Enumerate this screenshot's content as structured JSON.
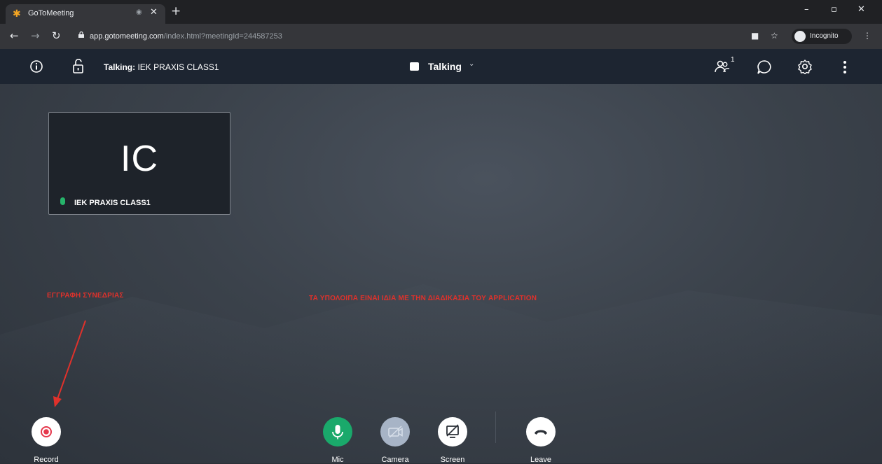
{
  "browser": {
    "tab_title": "GoToMeeting",
    "new_tab": "+",
    "url_host": "app.gotomeeting.com",
    "url_path": "/index.html?meetingId=244587253",
    "incognito_label": "Incognito"
  },
  "header": {
    "talking_prefix": "Talking:",
    "talking_name": "IEK PRAXIS CLASS1",
    "mode_label": "Talking",
    "attendee_count": "1"
  },
  "participant": {
    "initials": "IC",
    "name": "IEK PRAXIS CLASS1"
  },
  "annotations": {
    "record_note": "ΕΓΓΡΑΦΗ ΣΥΝΕΔΡΙΑΣ",
    "main_note": "ΤΑ ΥΠΟΛΟΙΠΑ ΕΙΝΑΙ ΙΔΙΑ ΜΕ ΤΗΝ ΔΙΑΔΙΚΑΣΙΑ ΤΟΥ APPLICATION"
  },
  "controls": {
    "record": "Record",
    "mic": "Mic",
    "camera": "Camera",
    "screen": "Screen",
    "leave": "Leave"
  },
  "colors": {
    "mic_active": "#1aa96b",
    "camera_off": "#a7b4c6",
    "annotation_red": "#e0312b",
    "record_red": "#e5384c"
  },
  "icons": {
    "favicon": "gotomeeting-logo-icon",
    "info": "info-icon",
    "lock": "unlock-icon",
    "people": "people-icon",
    "chat": "chat-icon",
    "settings": "gear-icon",
    "more": "more-vertical-icon"
  }
}
